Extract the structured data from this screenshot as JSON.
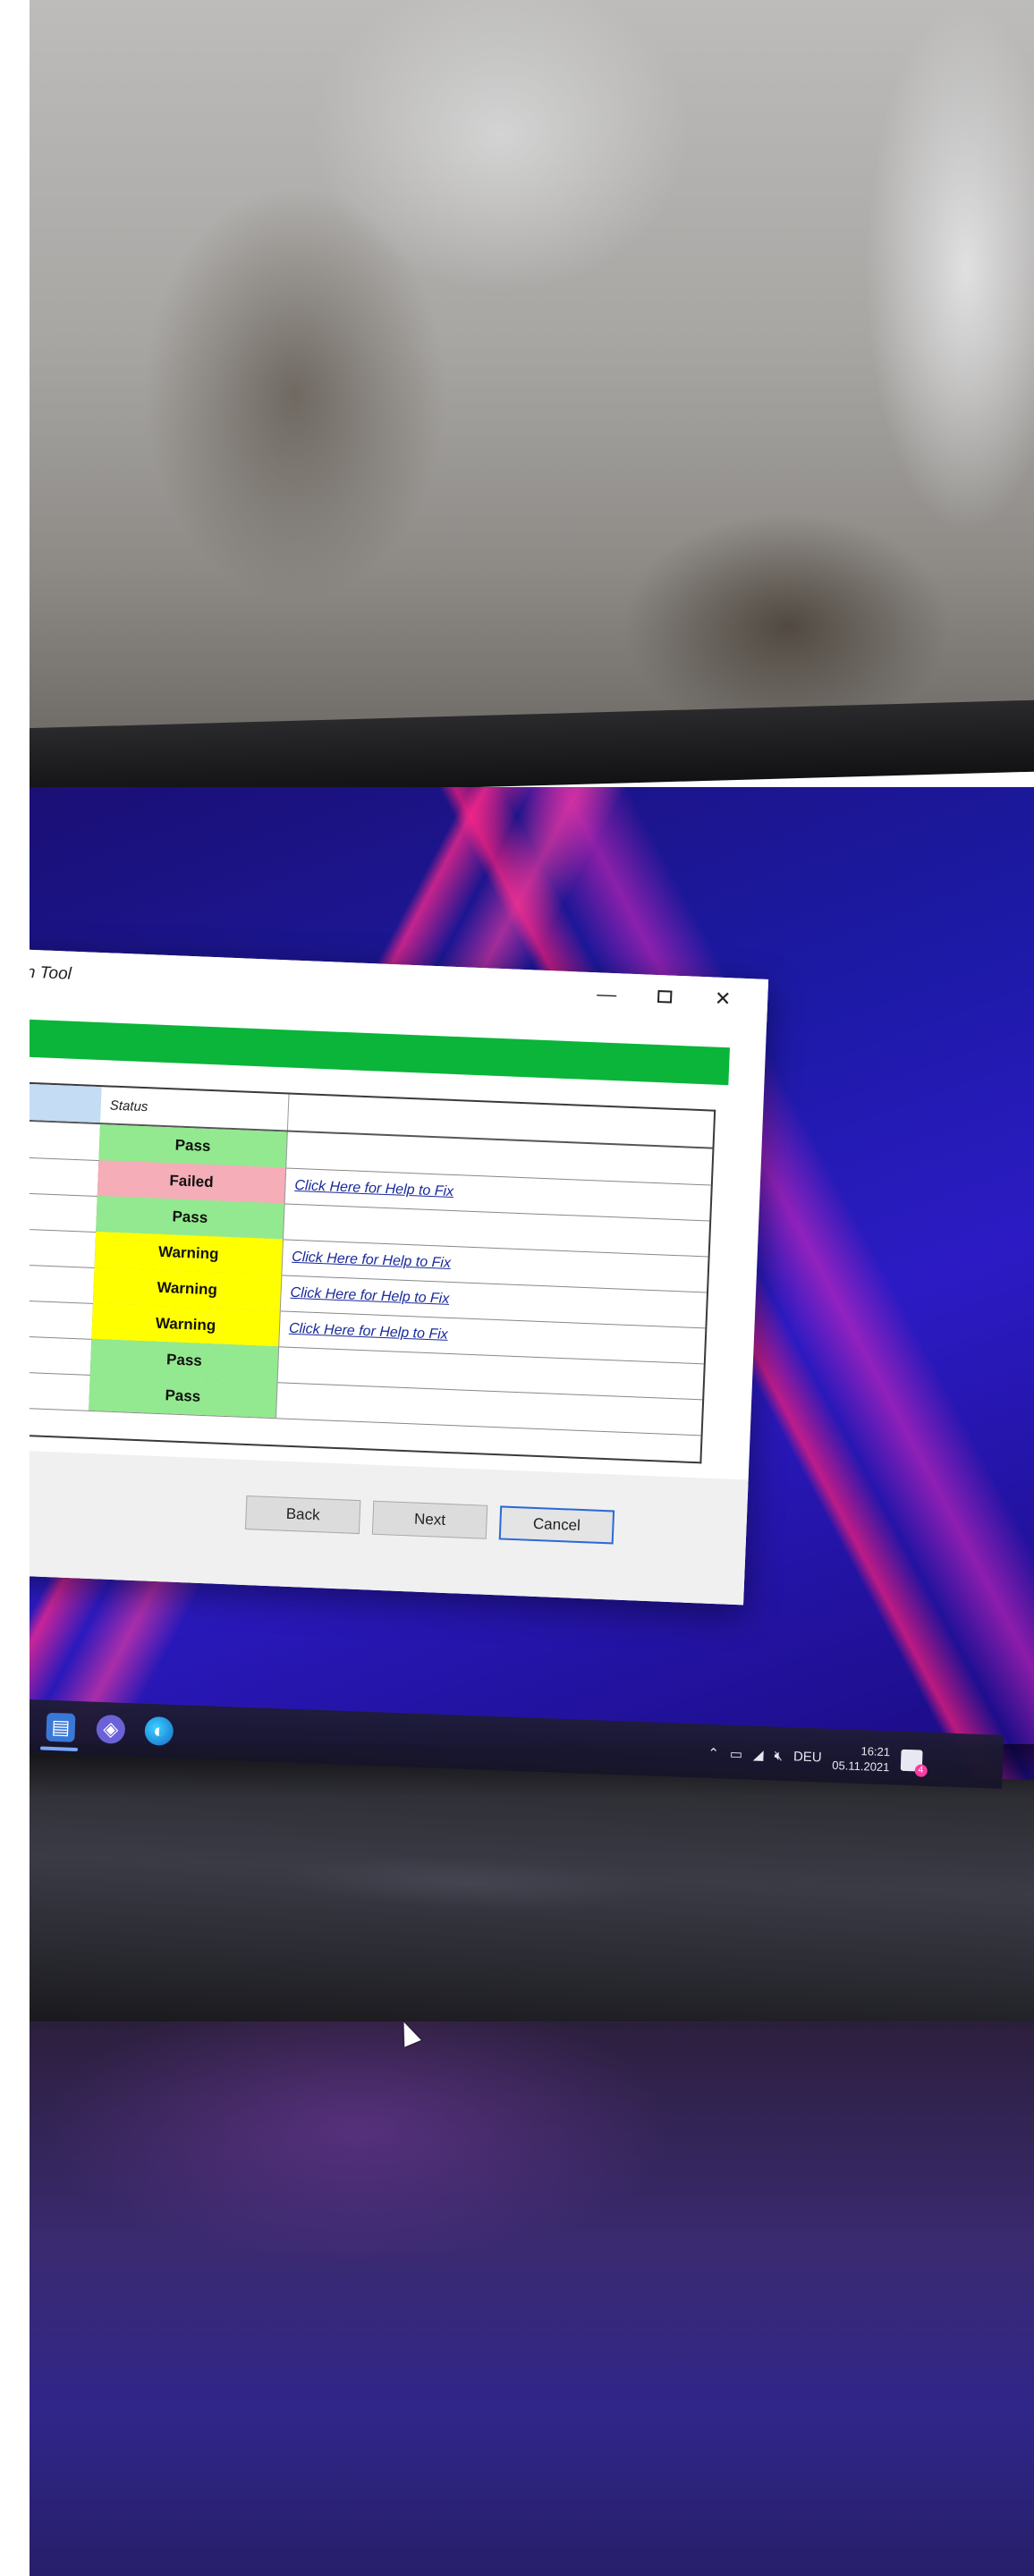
{
  "window": {
    "title": "tion Tool",
    "controls": {
      "minimize_icon": "minimize-icon",
      "maximize_icon": "maximize-icon",
      "close_icon": "close-icon",
      "minimize_glyph": "—",
      "close_glyph": "✕"
    }
  },
  "progress": {
    "value_percent": 100,
    "color": "#06ae2e"
  },
  "grid": {
    "header": {
      "status_label": "Status"
    },
    "rows": [
      {
        "status": "Pass",
        "link": ""
      },
      {
        "status": "Failed",
        "link": "Click Here for Help to Fix"
      },
      {
        "status": "Pass",
        "link": ""
      },
      {
        "status": "Warning",
        "link": "Click Here for Help to Fix"
      },
      {
        "status": "Warning",
        "link": "Click Here for Help to Fix"
      },
      {
        "status": "Warning",
        "link": "Click Here for Help to Fix"
      },
      {
        "status": "Pass",
        "link": ""
      },
      {
        "status": "Pass",
        "link": ""
      }
    ],
    "status_colors": {
      "Pass": "#93e98f",
      "Failed": "#f5adb8",
      "Warning": "#ffff00"
    }
  },
  "buttons": {
    "back_label": "Back",
    "next_label": "Next",
    "cancel_label": "Cancel"
  },
  "taskbar": {
    "icons": [
      "store-icon",
      "teams-icon",
      "edge-icon"
    ],
    "tray": {
      "language": "DEU",
      "time": "16:21",
      "date": "05.11.2021",
      "notification_count": "4"
    }
  }
}
